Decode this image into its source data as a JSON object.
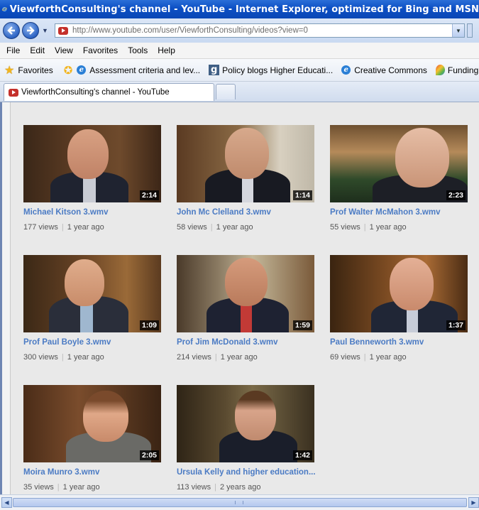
{
  "window": {
    "title": "ViewforthConsulting's channel - YouTube - Internet Explorer, optimized for Bing and MSN"
  },
  "address_bar": {
    "url": "http://www.youtube.com/user/ViewforthConsulting/videos?view=0"
  },
  "menu": {
    "items": [
      "File",
      "Edit",
      "View",
      "Favorites",
      "Tools",
      "Help"
    ]
  },
  "favorites_bar": {
    "favorites_label": "Favorites",
    "links": [
      {
        "label": "Assessment criteria and lev...",
        "icon": "ie-page-icon"
      },
      {
        "label": "Policy blogs  Higher Educati...",
        "icon": "g-site-icon"
      },
      {
        "label": "Creative Commons",
        "icon": "ie-page-icon"
      },
      {
        "label": "Funding and fir",
        "icon": "leaf-icon"
      }
    ]
  },
  "tabs": [
    {
      "label": "ViewforthConsulting's channel - YouTube",
      "active": true
    }
  ],
  "videos": [
    {
      "title": "Michael Kitson 3.wmv",
      "duration": "2:14",
      "views": "177 views",
      "age": "1 year ago"
    },
    {
      "title": "John Mc Clelland 3.wmv",
      "duration": "1:14",
      "views": "58 views",
      "age": "1 year ago"
    },
    {
      "title": "Prof Walter McMahon 3.wmv",
      "duration": "2:23",
      "views": "55 views",
      "age": "1 year ago"
    },
    {
      "title": "Prof Paul Boyle 3.wmv",
      "duration": "1:09",
      "views": "300 views",
      "age": "1 year ago"
    },
    {
      "title": "Prof Jim McDonald 3.wmv",
      "duration": "1:59",
      "views": "214 views",
      "age": "1 year ago"
    },
    {
      "title": "Paul Benneworth 3.wmv",
      "duration": "1:37",
      "views": "69 views",
      "age": "1 year ago"
    },
    {
      "title": "Moira Munro 3.wmv",
      "duration": "2:05",
      "views": "35 views",
      "age": "1 year ago"
    },
    {
      "title": "Ursula Kelly and higher education...",
      "duration": "1:42",
      "views": "113 views",
      "age": "2 years ago"
    }
  ],
  "colors": {
    "titlebar": "#0c4fc4",
    "link": "#4b7bc4",
    "youtube_red": "#c4302b"
  }
}
